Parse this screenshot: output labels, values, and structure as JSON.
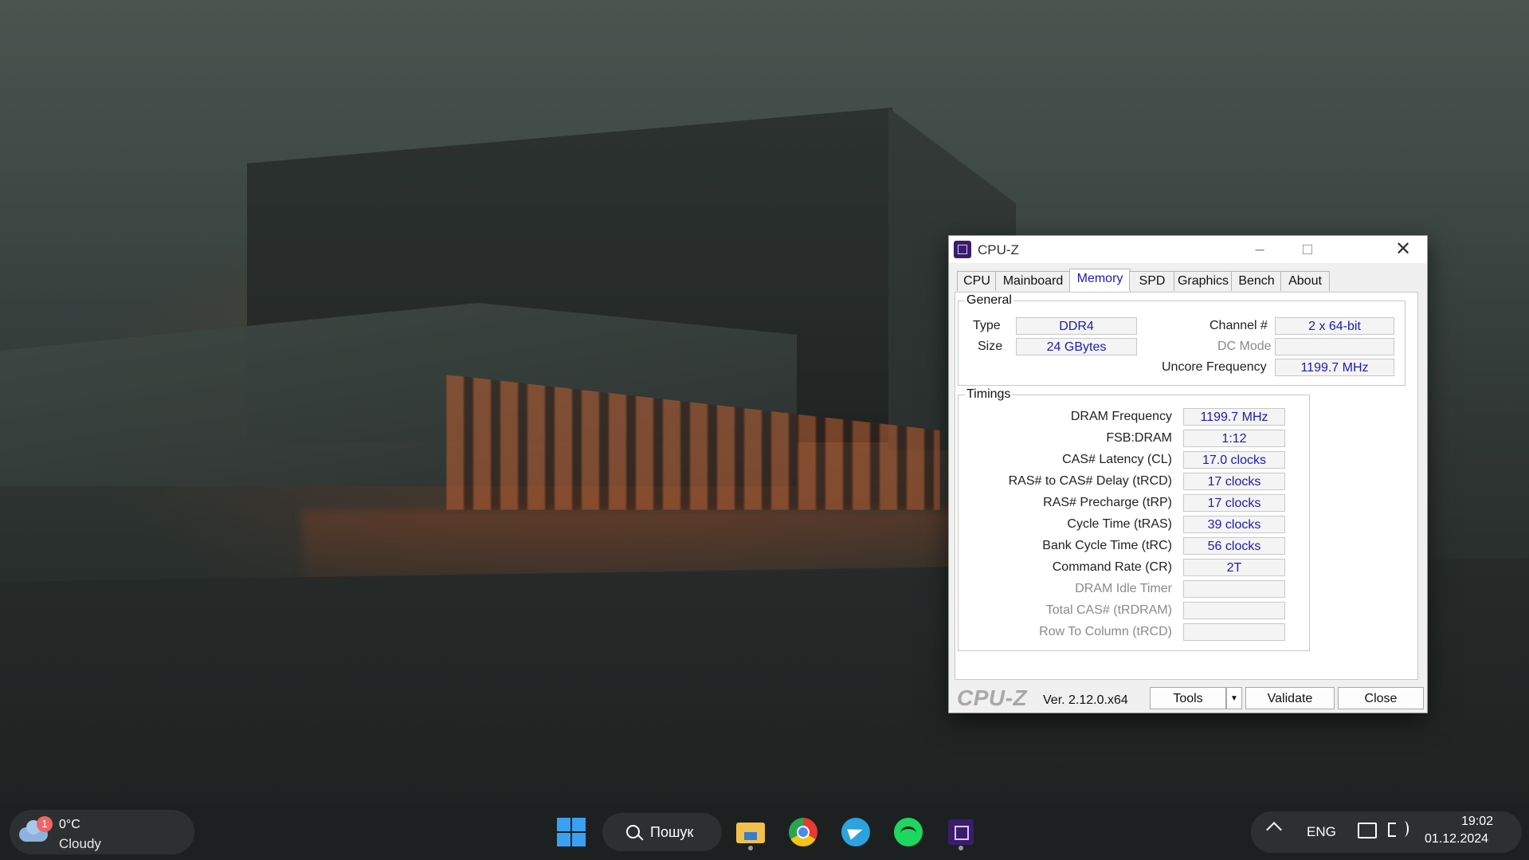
{
  "window": {
    "title": "CPU-Z",
    "tabs": [
      "CPU",
      "Mainboard",
      "Memory",
      "SPD",
      "Graphics",
      "Bench",
      "About"
    ],
    "active_tab": "Memory"
  },
  "general": {
    "title": "General",
    "type_label": "Type",
    "type_value": "DDR4",
    "size_label": "Size",
    "size_value": "24 GBytes",
    "channel_label": "Channel #",
    "channel_value": "2 x 64-bit",
    "dcmode_label": "DC Mode",
    "dcmode_value": "",
    "uncore_label": "Uncore Frequency",
    "uncore_value": "1199.7 MHz"
  },
  "timings": {
    "title": "Timings",
    "rows": [
      {
        "label": "DRAM Frequency",
        "value": "1199.7 MHz",
        "dim": false
      },
      {
        "label": "FSB:DRAM",
        "value": "1:12",
        "dim": false
      },
      {
        "label": "CAS# Latency (CL)",
        "value": "17.0 clocks",
        "dim": false
      },
      {
        "label": "RAS# to CAS# Delay (tRCD)",
        "value": "17 clocks",
        "dim": false
      },
      {
        "label": "RAS# Precharge (tRP)",
        "value": "17 clocks",
        "dim": false
      },
      {
        "label": "Cycle Time (tRAS)",
        "value": "39 clocks",
        "dim": false
      },
      {
        "label": "Bank Cycle Time (tRC)",
        "value": "56 clocks",
        "dim": false
      },
      {
        "label": "Command Rate (CR)",
        "value": "2T",
        "dim": false
      },
      {
        "label": "DRAM Idle Timer",
        "value": "",
        "dim": true
      },
      {
        "label": "Total CAS# (tRDRAM)",
        "value": "",
        "dim": true
      },
      {
        "label": "Row To Column (tRCD)",
        "value": "",
        "dim": true
      }
    ]
  },
  "footer": {
    "brand": "CPU-Z",
    "version": "Ver. 2.12.0.x64",
    "tools_label": "Tools",
    "validate_label": "Validate",
    "close_label": "Close"
  },
  "taskbar": {
    "weather_badge": "1",
    "weather_temp": "0°C",
    "weather_desc": "Cloudy",
    "search_label": "Пошук",
    "language": "ENG",
    "time": "19:02",
    "date": "01.12.2024",
    "accent": "#3aa0f2"
  }
}
